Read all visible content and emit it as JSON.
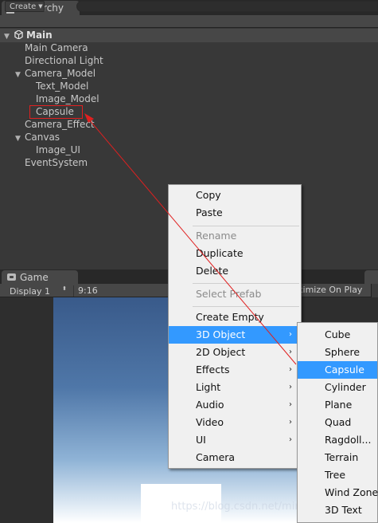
{
  "hierarchy": {
    "tab_label": "Hierarchy",
    "create_label": "Create",
    "scene_name": "Main",
    "items": [
      {
        "label": "Main Camera"
      },
      {
        "label": "Directional Light"
      },
      {
        "label": "Camera_Model"
      },
      {
        "label": "Text_Model"
      },
      {
        "label": "Image_Model"
      },
      {
        "label": "Capsule"
      },
      {
        "label": "Camera_Effect"
      },
      {
        "label": "Canvas"
      },
      {
        "label": "Image_UI"
      },
      {
        "label": "EventSystem"
      }
    ]
  },
  "game": {
    "tab_label": "Game",
    "display_label": "Display 1",
    "aspect_label": "9:16",
    "maximize_label": "ximize On Play"
  },
  "context_menu": {
    "items": [
      {
        "label": "Copy"
      },
      {
        "label": "Paste"
      },
      {
        "label": "Rename"
      },
      {
        "label": "Duplicate"
      },
      {
        "label": "Delete"
      },
      {
        "label": "Select Prefab"
      },
      {
        "label": "Create Empty"
      },
      {
        "label": "3D Object"
      },
      {
        "label": "2D Object"
      },
      {
        "label": "Effects"
      },
      {
        "label": "Light"
      },
      {
        "label": "Audio"
      },
      {
        "label": "Video"
      },
      {
        "label": "UI"
      },
      {
        "label": "Camera"
      }
    ]
  },
  "submenu_3d": {
    "items": [
      {
        "label": "Cube"
      },
      {
        "label": "Sphere"
      },
      {
        "label": "Capsule"
      },
      {
        "label": "Cylinder"
      },
      {
        "label": "Plane"
      },
      {
        "label": "Quad"
      },
      {
        "label": "Ragdoll..."
      },
      {
        "label": "Terrain"
      },
      {
        "label": "Tree"
      },
      {
        "label": "Wind Zone"
      },
      {
        "label": "3D Text"
      }
    ]
  },
  "watermark": "https://blog.csdn.net/mina",
  "colors": {
    "highlight": "#3399ff",
    "annotation_red": "#e02020",
    "panel_bg": "#383838"
  }
}
